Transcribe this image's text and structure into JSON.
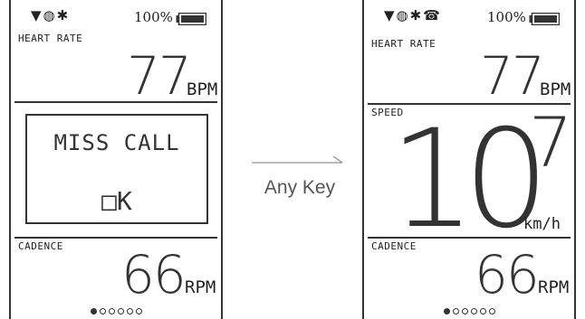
{
  "left": {
    "status_icons": "▼◍✱",
    "battery_text": "100%",
    "heart_rate": {
      "label": "HEART RATE",
      "value": "77",
      "unit": "BPM"
    },
    "dialog": {
      "message": "MISS CALL",
      "ok": "□K"
    },
    "cadence": {
      "label": "CADENCE",
      "value": "66",
      "unit": "RPM"
    },
    "page_dots": {
      "total": 6,
      "active": 1
    }
  },
  "transition": {
    "label": "Any Key"
  },
  "right": {
    "status_icons": "▼◍✱☎",
    "battery_text": "100%",
    "heart_rate": {
      "label": "HEART RATE",
      "value": "77",
      "unit": "BPM"
    },
    "speed": {
      "label": "SPEED",
      "integer": "10",
      "decimal": "7",
      "unit": "km/h"
    },
    "cadence": {
      "label": "CADENCE",
      "value": "66",
      "unit": "RPM"
    },
    "page_dots": {
      "total": 6,
      "active": 1
    }
  }
}
